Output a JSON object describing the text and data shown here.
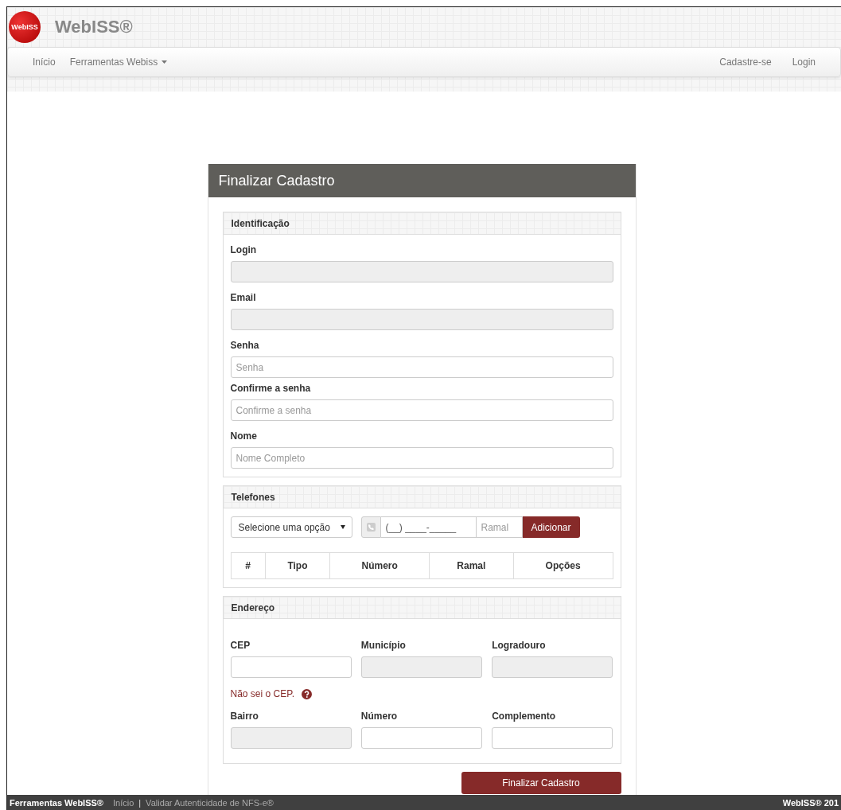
{
  "brand": {
    "logo_text": "WebISS",
    "title": "WebISS®"
  },
  "nav": {
    "left": [
      {
        "label": "Início",
        "dropdown": false
      },
      {
        "label": "Ferramentas Webiss",
        "dropdown": true
      }
    ],
    "right": [
      {
        "label": "Cadastre-se"
      },
      {
        "label": "Login"
      }
    ]
  },
  "card": {
    "title": "Finalizar Cadastro"
  },
  "identificacao": {
    "title": "Identificação",
    "fields": [
      {
        "label": "Login",
        "disabled": true
      },
      {
        "label": "Email",
        "disabled": true
      },
      {
        "label": "Senha",
        "placeholder": "Senha",
        "disabled": false
      },
      {
        "label": "Confirme a senha",
        "placeholder": "Confirme a senha",
        "disabled": false
      },
      {
        "label": "Nome",
        "placeholder": "Nome Completo",
        "disabled": false
      }
    ]
  },
  "telefones": {
    "title": "Telefones",
    "select": "Selecione uma opção",
    "phone_value": "(__) ____-_____",
    "ramal_placeholder": "Ramal",
    "add_button": "Adicionar",
    "columns": [
      "#",
      "Tipo",
      "Número",
      "Ramal",
      "Opções"
    ]
  },
  "endereco": {
    "title": "Endereço",
    "rows": [
      [
        {
          "label": "CEP",
          "disabled": false
        },
        {
          "label": "Município",
          "disabled": true
        },
        {
          "label": "Logradouro",
          "disabled": true
        }
      ],
      [
        {
          "label": "Bairro",
          "disabled": true
        },
        {
          "label": "Número",
          "disabled": false
        },
        {
          "label": "Complemento",
          "disabled": false
        }
      ]
    ],
    "cep_help": "Não sei o CEP."
  },
  "submit": "Finalizar Cadastro",
  "footer": {
    "left_title": "Ferramentas WebISS®",
    "links": [
      "Início",
      "Validar Autenticidade de NFS-e®"
    ],
    "separator": "|",
    "right": "WebISS® 201"
  }
}
